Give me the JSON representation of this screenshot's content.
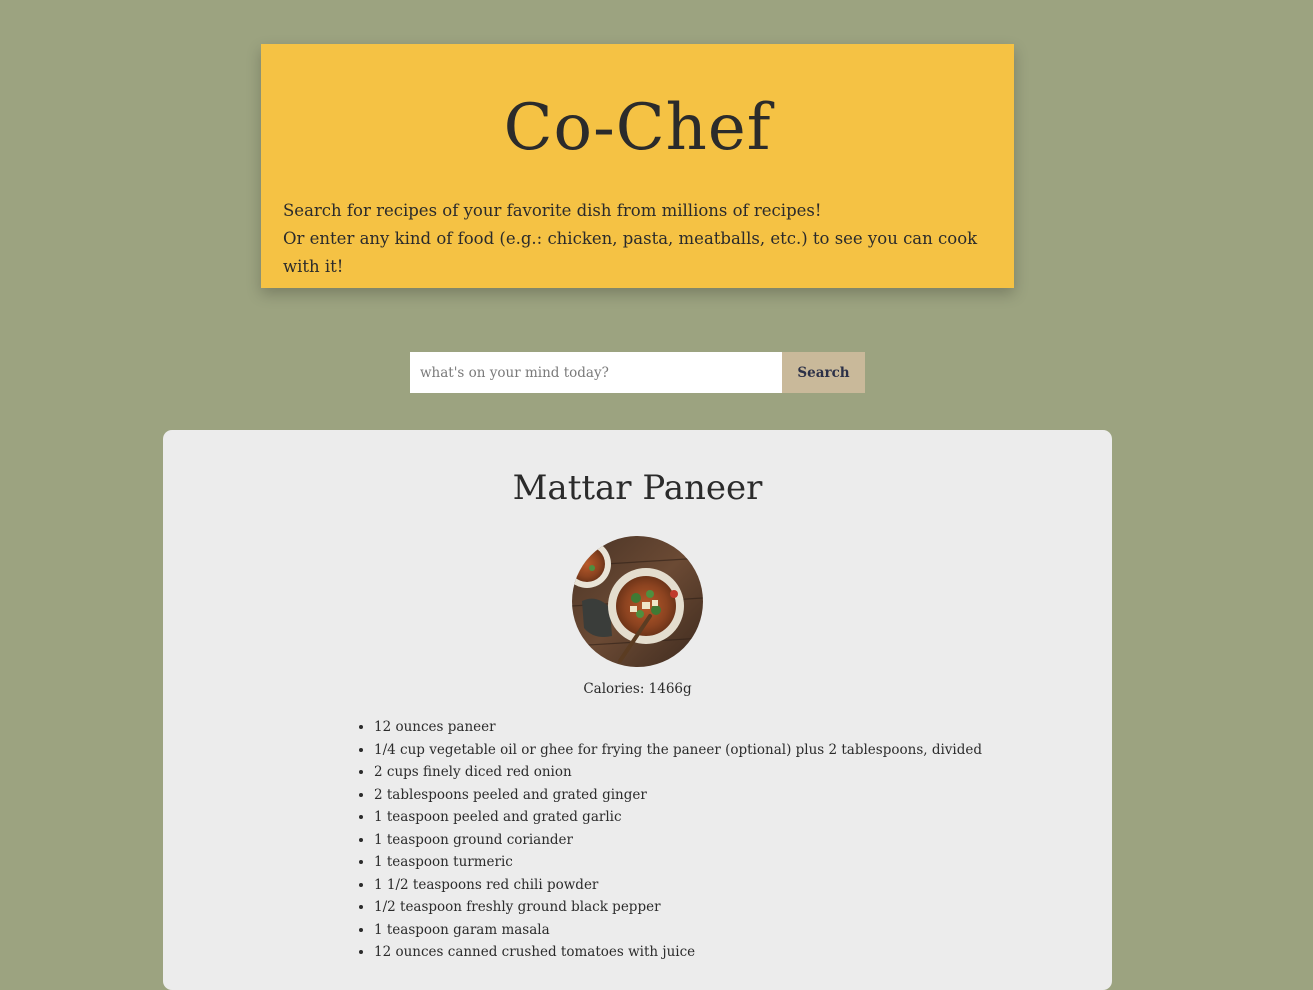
{
  "header": {
    "title": "Co-Chef",
    "line1": "Search for recipes of your favorite dish from millions of recipes!",
    "line2": "Or enter any kind of food (e.g.: chicken, pasta, meatballs, etc.) to see you can cook with it!"
  },
  "search": {
    "placeholder": "what's on your mind today?",
    "value": "",
    "button_label": "Search"
  },
  "recipe": {
    "title": "Mattar Paneer",
    "image_alt": "Mattar Paneer dish",
    "calories": "Calories: 1466g",
    "ingredients": [
      "12 ounces paneer",
      "1/4 cup vegetable oil or ghee for frying the paneer (optional) plus 2 tablespoons, divided",
      "2 cups finely diced red onion",
      "2 tablespoons peeled and grated ginger",
      "1 teaspoon peeled and grated garlic",
      "1 teaspoon ground coriander",
      "1 teaspoon turmeric",
      "1 1/2 teaspoons red chili powder",
      "1/2 teaspoon freshly ground black pepper",
      "1 teaspoon garam masala",
      "12 ounces canned crushed tomatoes with juice"
    ]
  },
  "colors": {
    "page_bg": "#9ca380",
    "header_bg": "#f5c244",
    "button_bg": "#c9b99a",
    "card_bg": "#ececec"
  }
}
